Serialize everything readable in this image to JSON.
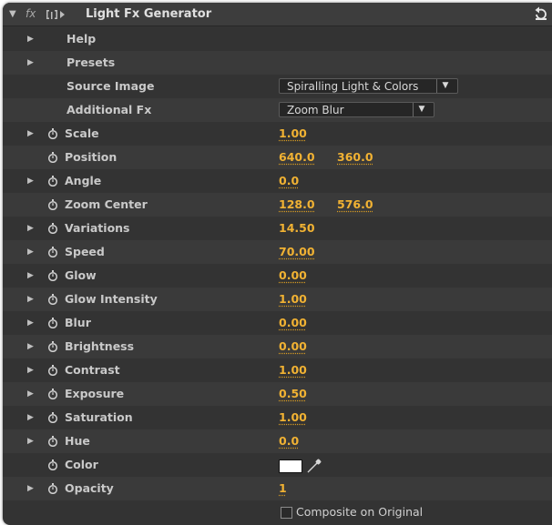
{
  "effect": {
    "fx_label": "fx",
    "title": "Light Fx Generator",
    "icons": {
      "fx_toggle": "fx-icon",
      "effect_glyph": "effect-controls-icon",
      "reset": "reset-icon"
    }
  },
  "rows": [
    {
      "label": "Help",
      "type": "group"
    },
    {
      "label": "Presets",
      "type": "group"
    },
    {
      "label": "Source Image",
      "type": "dropdown",
      "value": "Spiralling Light & Colors"
    },
    {
      "label": "Additional Fx",
      "type": "dropdown",
      "value": "Zoom Blur"
    },
    {
      "label": "Scale",
      "value": "1.00",
      "expandable": true
    },
    {
      "label": "Position",
      "value": "640.0",
      "value2": "360.0",
      "expandable": false
    },
    {
      "label": "Angle",
      "value": "0.0",
      "expandable": true
    },
    {
      "label": "Zoom Center",
      "value": "128.0",
      "value2": "576.0",
      "expandable": false
    },
    {
      "label": "Variations",
      "value": "14.50",
      "expandable": true
    },
    {
      "label": "Speed",
      "value": "70.00",
      "expandable": true
    },
    {
      "label": "Glow",
      "value": "0.00",
      "expandable": true
    },
    {
      "label": "Glow Intensity",
      "value": "1.00",
      "expandable": true
    },
    {
      "label": "Blur",
      "value": "0.00",
      "expandable": true
    },
    {
      "label": "Brightness",
      "value": "0.00",
      "expandable": true
    },
    {
      "label": "Contrast",
      "value": "1.00",
      "expandable": true
    },
    {
      "label": "Exposure",
      "value": "0.50",
      "expandable": true
    },
    {
      "label": "Saturation",
      "value": "1.00",
      "expandable": true
    },
    {
      "label": "Hue",
      "value": "0.0",
      "expandable": true
    },
    {
      "label": "Color",
      "type": "color",
      "value": "#ffffff",
      "expandable": false
    },
    {
      "label": "Opacity",
      "value": "1",
      "expandable": true
    },
    {
      "label": "Composite on Original",
      "type": "checkbox",
      "checked": false
    }
  ],
  "colors": {
    "panel_bg": "#333333",
    "value_accent": "#f1b233",
    "label_text": "#c9c9c9"
  }
}
